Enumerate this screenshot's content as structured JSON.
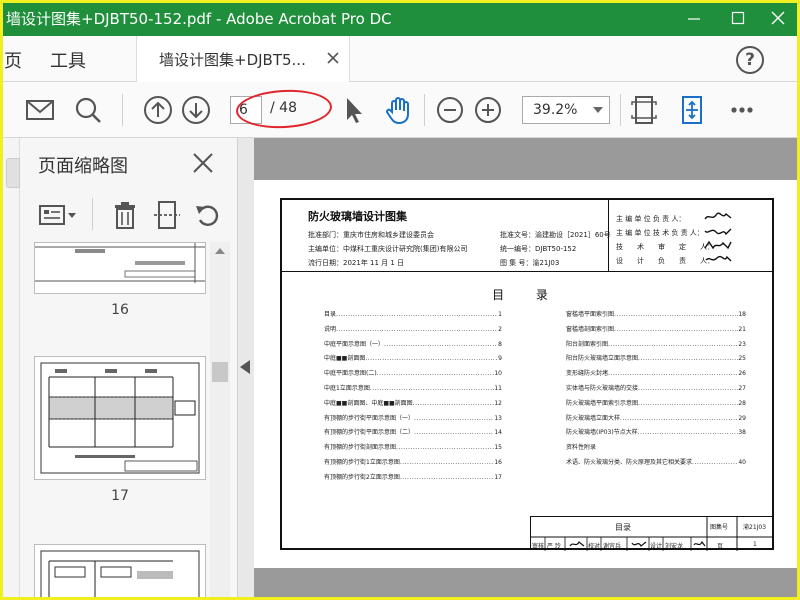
{
  "window": {
    "title": "墙设计图集+DJBT50-152.pdf - Adobe Acrobat Pro DC"
  },
  "tabs": {
    "home": "页",
    "tools": "工具",
    "doc_tab": "墙设计图集+DJBT5...",
    "help": "?"
  },
  "toolbar": {
    "page_current": "6",
    "page_total": "/ 48",
    "zoom": "39.2%"
  },
  "panel": {
    "title": "页面缩略图",
    "thumbnails": [
      {
        "page": "16"
      },
      {
        "page": "17"
      }
    ]
  },
  "document": {
    "header": {
      "title": "防火玻璃墙设计图集",
      "dept": "批准部门：重庆市住房和城乡建设委员会",
      "unit": "主编单位：中煤科工重庆设计研究院(集团)有限公司",
      "date": "流行日期：2021年 11 月 1 日",
      "approval_no": "批准文号：渝建勘设［2021］60号",
      "serial_no": "统一编号：DJBT50-152",
      "atlas_no": "图 集 号：渝21J03",
      "roles": [
        "主 编 单 位 负 责 人：",
        "主 编 单 位 技 术 负 责 人：",
        "技　　术　　审　　定　　人：",
        "设　　计　　负　　责　　人："
      ]
    },
    "contents_title": "目 录",
    "toc_left": [
      {
        "t": "目录",
        "n": "1"
      },
      {
        "t": "说明",
        "n": "2"
      },
      {
        "t": "中庭平面示意图（一）",
        "n": "8"
      },
      {
        "t": "中庭■■剖面图",
        "n": "9"
      },
      {
        "t": "中庭平面示意图(二)",
        "n": "10"
      },
      {
        "t": "中庭1立面示意图",
        "n": "11"
      },
      {
        "t": "中庭■■剖面图、中庭■■剖面图",
        "n": "12"
      },
      {
        "t": "有顶棚的步行街平面示意图（一）",
        "n": "13"
      },
      {
        "t": "有顶棚的步行街平面示意图（二）",
        "n": "14"
      },
      {
        "t": "有顶棚的步行街剖面示意图",
        "n": "15"
      },
      {
        "t": "有顶棚的步行街1立面示意图",
        "n": "16"
      },
      {
        "t": "有顶棚的步行街2立面示意图",
        "n": "17"
      }
    ],
    "toc_right": [
      {
        "t": "窗槛墙平面索引图",
        "n": "18"
      },
      {
        "t": "窗槛墙剖面索引图",
        "n": "21"
      },
      {
        "t": "阳台剖面索引图",
        "n": "23"
      },
      {
        "t": "阳台防火玻璃墙立面示意图",
        "n": "25"
      },
      {
        "t": "变形缝防火封堵",
        "n": "26"
      },
      {
        "t": "实体墙与防火玻璃墙的交接",
        "n": "27"
      },
      {
        "t": "防火玻璃墙平面索引示意图",
        "n": "28"
      },
      {
        "t": "防火玻璃墙立面大样",
        "n": "29"
      },
      {
        "t": "防火玻璃墙(IP03)节点大样",
        "n": "38"
      },
      {
        "t": "资料性附录",
        "n": ""
      },
      {
        "t": "术语、防火玻璃分类、防火原理及其它相关要求",
        "n": "40"
      }
    ],
    "titleblock": {
      "name": "目录",
      "atlas_label": "图集号",
      "atlas_value": "渝21J03",
      "page_label": "页",
      "page_value": "1",
      "cells": [
        "审核",
        "严 玲",
        "校对",
        "谢宜兵",
        "设计",
        "刘安龙"
      ]
    }
  }
}
